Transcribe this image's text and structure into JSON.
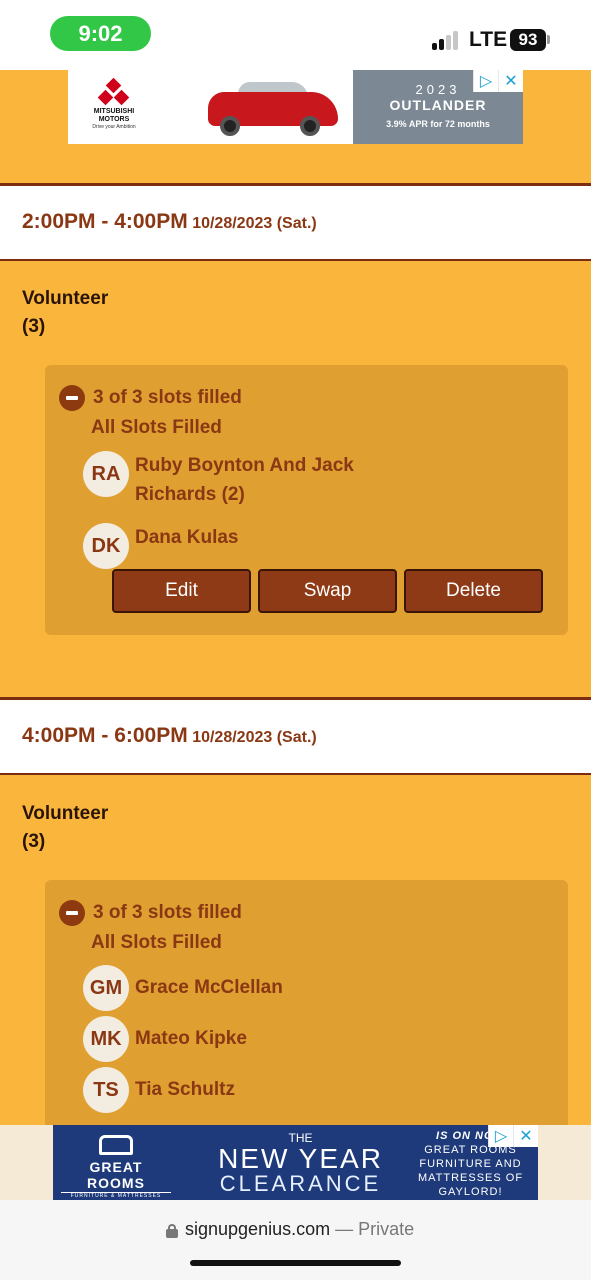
{
  "status_bar": {
    "time": "9:02",
    "network": "LTE",
    "battery": "93"
  },
  "top_ad": {
    "brand": "MITSUBISHI MOTORS",
    "tagline": "Drive your Ambition",
    "year": "2023",
    "model": "OUTLANDER",
    "offer": "3.9% APR for 72 months",
    "adchoices_icon": "adchoices-icon",
    "close_icon": "close-icon"
  },
  "shifts": [
    {
      "time_range": "2:00PM - 4:00PM",
      "date": "10/28/2023 (Sat.)",
      "role": "Volunteer",
      "role_count": "(3)",
      "slots_status": "3 of 3 slots filled",
      "slots_filled_label": "All Slots Filled",
      "people": [
        {
          "initials": "RA",
          "name": "Ruby Boynton And Jack Richards (2)"
        },
        {
          "initials": "DK",
          "name": "Dana Kulas"
        }
      ],
      "actions": {
        "edit": "Edit",
        "swap": "Swap",
        "delete": "Delete"
      }
    },
    {
      "time_range": "4:00PM - 6:00PM",
      "date": "10/28/2023 (Sat.)",
      "role": "Volunteer",
      "role_count": "(3)",
      "slots_status": "3 of 3 slots filled",
      "slots_filled_label": "All Slots Filled",
      "people": [
        {
          "initials": "GM",
          "name": "Grace McClellan"
        },
        {
          "initials": "MK",
          "name": "Mateo Kipke"
        },
        {
          "initials": "TS",
          "name": "Tia Schultz"
        }
      ]
    }
  ],
  "bottom_ad": {
    "brand": "GREAT ROOMS",
    "brand_sub": "FURNITURE & MATTRESSES",
    "the": "THE",
    "headline": "NEW YEAR",
    "headline2": "CLEARANCE",
    "right_line1": "IS ON NOW",
    "right_line2": "GREAT ROOMS",
    "right_line3": "FURNITURE AND",
    "right_line4": "MATTRESSES OF",
    "right_line5": "GAYLORD!"
  },
  "url_bar": {
    "domain": "signupgenius.com",
    "separator": " — ",
    "mode": "Private"
  },
  "colors": {
    "page_bg": "#fab63c",
    "accent": "#8a3713",
    "slot_box": "#dfa031",
    "button": "#8e3a16"
  }
}
